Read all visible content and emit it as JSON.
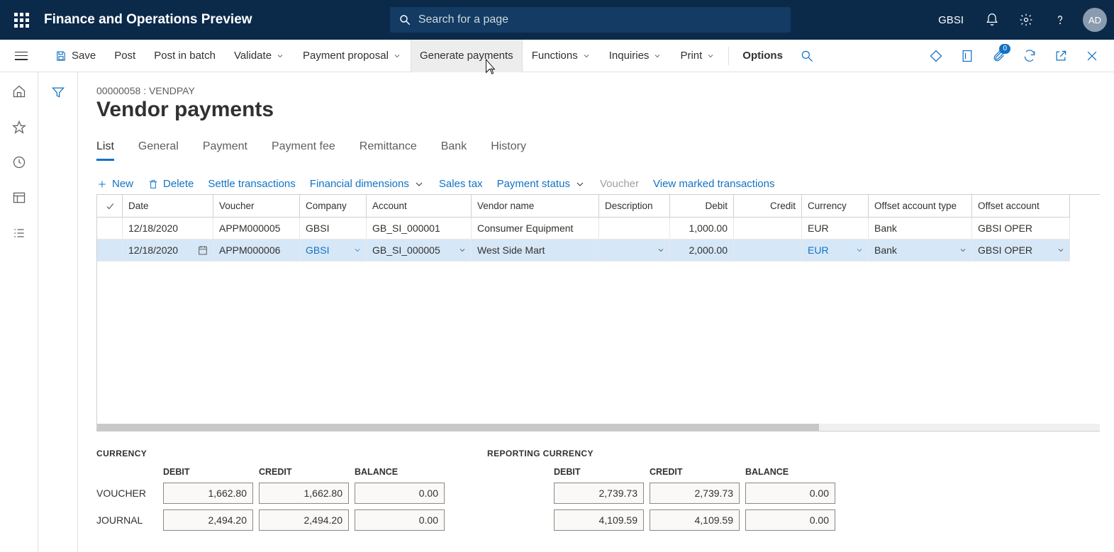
{
  "header": {
    "app_title": "Finance and Operations Preview",
    "search_placeholder": "Search for a page",
    "company": "GBSI",
    "avatar_initials": "AD"
  },
  "action_bar": {
    "save": "Save",
    "post": "Post",
    "post_in_batch": "Post in batch",
    "validate": "Validate",
    "payment_proposal": "Payment proposal",
    "generate_payments": "Generate payments",
    "functions": "Functions",
    "inquiries": "Inquiries",
    "print": "Print",
    "options": "Options",
    "attachments_badge": "0"
  },
  "page": {
    "breadcrumb": "00000058 : VENDPAY",
    "title": "Vendor payments"
  },
  "tabs": {
    "list": "List",
    "general": "General",
    "payment": "Payment",
    "payment_fee": "Payment fee",
    "remittance": "Remittance",
    "bank": "Bank",
    "history": "History"
  },
  "commands": {
    "new": "New",
    "delete": "Delete",
    "settle_transactions": "Settle transactions",
    "financial_dimensions": "Financial dimensions",
    "sales_tax": "Sales tax",
    "payment_status": "Payment status",
    "voucher": "Voucher",
    "view_marked": "View marked transactions"
  },
  "grid": {
    "headers": {
      "date": "Date",
      "voucher": "Voucher",
      "company": "Company",
      "account": "Account",
      "vendor_name": "Vendor name",
      "description": "Description",
      "debit": "Debit",
      "credit": "Credit",
      "currency": "Currency",
      "offset_type": "Offset account type",
      "offset_account": "Offset account"
    },
    "rows": [
      {
        "date": "12/18/2020",
        "voucher": "APPM000005",
        "company": "GBSI",
        "account": "GB_SI_000001",
        "vendor_name": "Consumer Equipment",
        "description": "",
        "debit": "1,000.00",
        "credit": "",
        "currency": "EUR",
        "offset_type": "Bank",
        "offset_account": "GBSI OPER"
      },
      {
        "date": "12/18/2020",
        "voucher": "APPM000006",
        "company": "GBSI",
        "account": "GB_SI_000005",
        "vendor_name": "West Side Mart",
        "description": "",
        "debit": "2,000.00",
        "credit": "",
        "currency": "EUR",
        "offset_type": "Bank",
        "offset_account": "GBSI OPER"
      }
    ]
  },
  "totals": {
    "currency": {
      "title": "CURRENCY",
      "headers": {
        "debit": "DEBIT",
        "credit": "CREDIT",
        "balance": "BALANCE"
      },
      "voucher_label": "VOUCHER",
      "journal_label": "JOURNAL",
      "voucher": {
        "debit": "1,662.80",
        "credit": "1,662.80",
        "balance": "0.00"
      },
      "journal": {
        "debit": "2,494.20",
        "credit": "2,494.20",
        "balance": "0.00"
      }
    },
    "reporting": {
      "title": "REPORTING CURRENCY",
      "headers": {
        "debit": "DEBIT",
        "credit": "CREDIT",
        "balance": "BALANCE"
      },
      "voucher": {
        "debit": "2,739.73",
        "credit": "2,739.73",
        "balance": "0.00"
      },
      "journal": {
        "debit": "4,109.59",
        "credit": "4,109.59",
        "balance": "0.00"
      }
    }
  }
}
